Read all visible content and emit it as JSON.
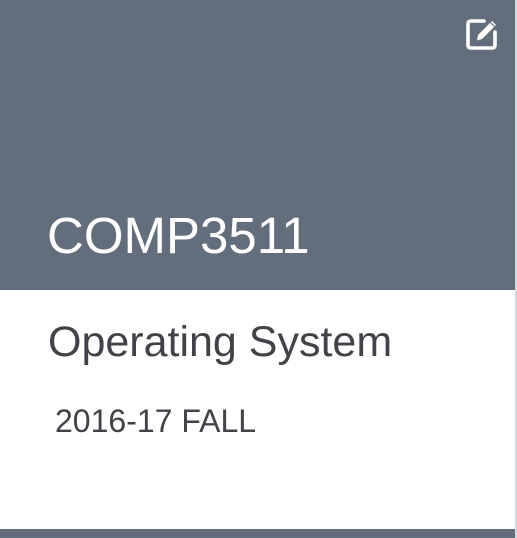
{
  "course_card": {
    "code": "COMP3511",
    "name": "Operating System",
    "term": "2016-17 FALL",
    "header_color": "#626e7b",
    "edit_icon": "edit-icon"
  }
}
